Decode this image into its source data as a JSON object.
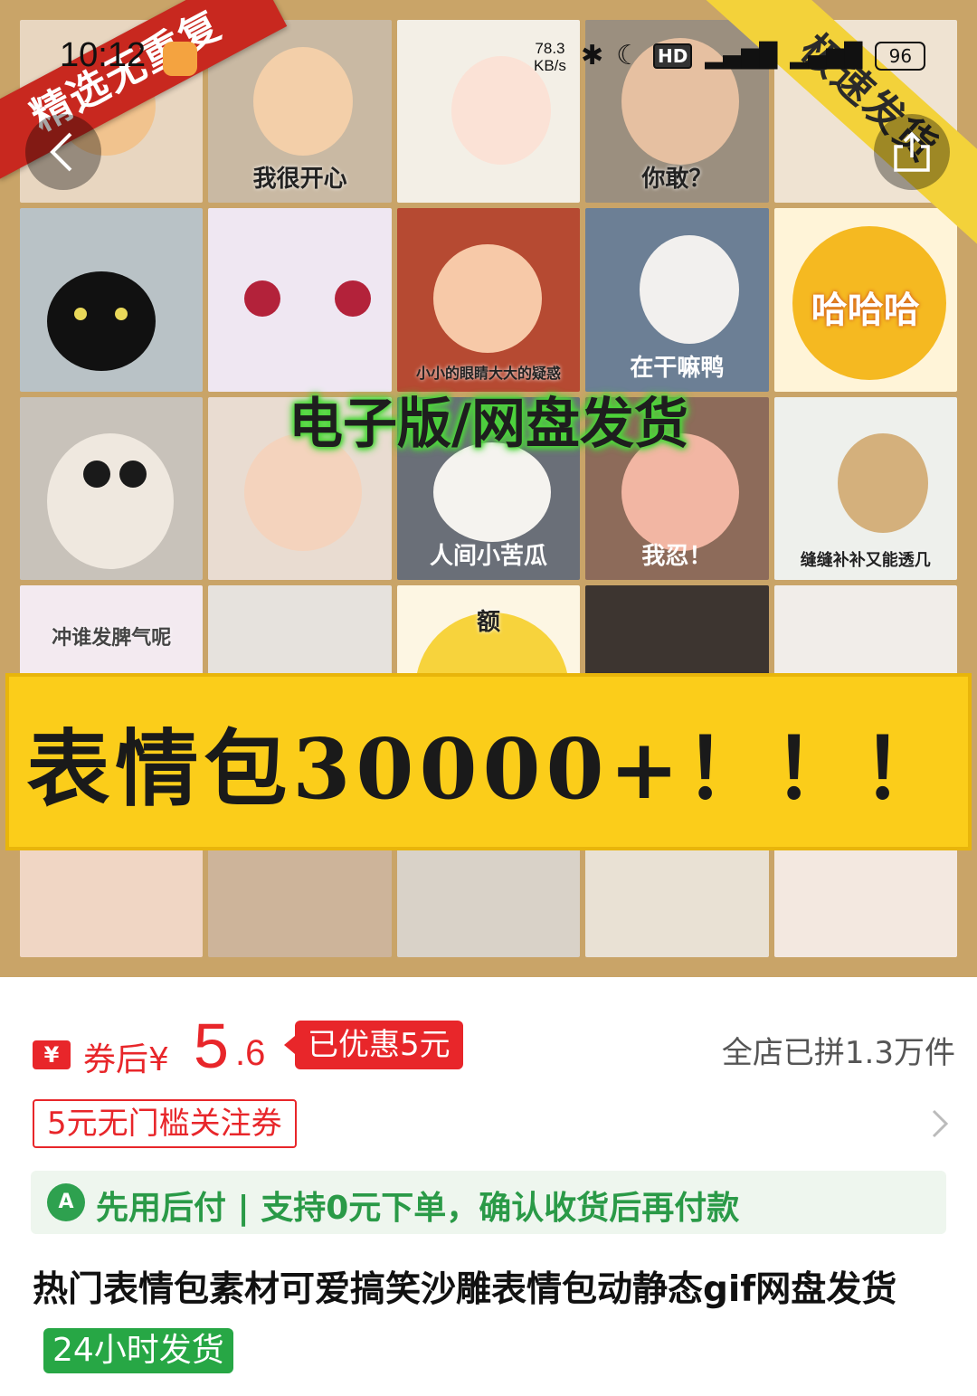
{
  "status_bar": {
    "time": "10:12",
    "net_speed_value": "78.3",
    "net_speed_unit": "KB/s",
    "hd_label": "HD",
    "battery": "96"
  },
  "hero": {
    "ribbon_left": "精选无重复",
    "ribbon_right": "极速发货",
    "green_banner": "电子版/网盘发货",
    "yellow_banner": "表情包30000+！！！",
    "captions": {
      "happy": "我很开心",
      "dare": "你敢？",
      "ha": "哈哈哈",
      "small_eyes": "小小的眼睛大大的疑惑",
      "what": "在干嘛鸭",
      "bitter": "人间小苦瓜",
      "endure": "我忍！",
      "patch": "缝缝补补又能透几",
      "temper": "冲谁发脾气呢",
      "e": "额"
    }
  },
  "product": {
    "yen_icon": "¥",
    "after_coupon_label": "券后",
    "currency": "¥",
    "price_int": "5",
    "price_dec": ".6",
    "discount_text": "已优惠5元",
    "sold_text": "全店已拼1.3万件",
    "coupon_text": "5元无门槛关注券",
    "pay_later_text": "先用后付 | 支持0元下单，确认收货后再付款",
    "title": "热门表情包素材可爱搞笑沙雕表情包动静态gif网盘发货",
    "ship_tag": "24小时发货"
  },
  "icons": {
    "back": "chevron-left-icon",
    "share": "share-icon",
    "pay_later": "pay-later-shield-icon"
  },
  "colors": {
    "price_red": "#e8262a",
    "pay_green": "#2ea14f",
    "banner_yellow": "#fbcd1a"
  }
}
